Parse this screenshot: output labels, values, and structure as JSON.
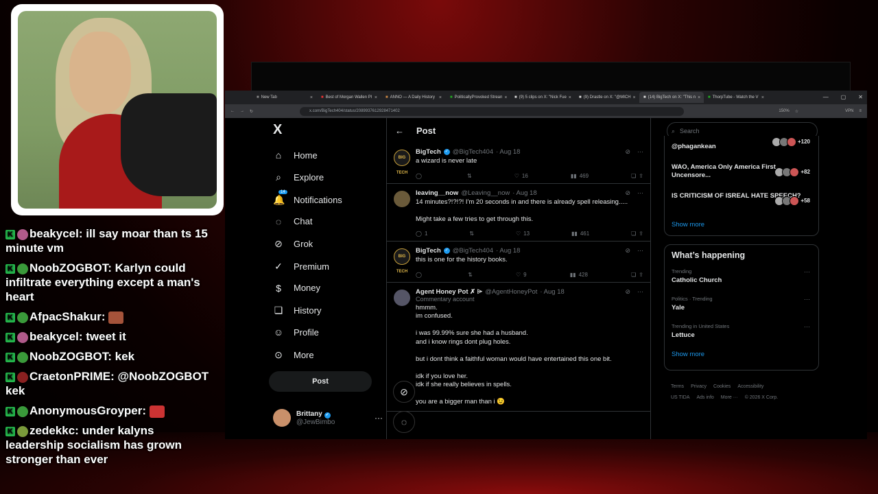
{
  "browser": {
    "tabs": [
      {
        "label": "New Tab"
      },
      {
        "label": "Best of Morgan Wallen Pl"
      },
      {
        "label": "ANNO — A Daily History"
      },
      {
        "label": "PoliticallyProvoked Strean"
      },
      {
        "label": "(9) 5 clips on X: \"Nick Fue"
      },
      {
        "label": "(9) Drastle on X: \"@MICH"
      },
      {
        "label": "(14) BigTech on X: \"This n"
      },
      {
        "label": "ThorpTube - Watch the V"
      }
    ],
    "url": "x.com/BigTech404/status/2089937612928471402",
    "zoom": "150%",
    "vpn": "VPN"
  },
  "sidebar": {
    "logo": "X",
    "items": [
      {
        "label": "Home",
        "icon": "home-icon"
      },
      {
        "label": "Explore",
        "icon": "search-icon"
      },
      {
        "label": "Notifications",
        "icon": "bell-icon",
        "badge": "14"
      },
      {
        "label": "Chat",
        "icon": "chat-icon"
      },
      {
        "label": "Grok",
        "icon": "grok-icon"
      },
      {
        "label": "Premium",
        "icon": "premium-icon"
      },
      {
        "label": "Money",
        "icon": "money-icon"
      },
      {
        "label": "History",
        "icon": "bookmark-icon"
      },
      {
        "label": "Profile",
        "icon": "profile-icon"
      },
      {
        "label": "More",
        "icon": "more-icon"
      }
    ],
    "post_label": "Post",
    "account": {
      "name": "Brittany",
      "handle": "@JewBimbo"
    }
  },
  "timeline": {
    "title": "Post",
    "tweets": [
      {
        "name": "BigTech",
        "handle": "@BigTech404",
        "date": "· Aug 18",
        "avatar_text": "BIG TECH",
        "lines": [
          "a wizard is never late"
        ],
        "reposts": "",
        "likes": "16",
        "views": "469",
        "replies": ""
      },
      {
        "name": "leaving__now",
        "handle": "@Leaving__now",
        "date": "· Aug 18",
        "avatar_text": "",
        "lines": [
          "14 minutes?!?!?! I'm 20 seconds in and there is already spell releasing.....",
          "",
          "Might take a few tries to get through this."
        ],
        "replies": "1",
        "reposts": "",
        "likes": "13",
        "views": "461"
      },
      {
        "name": "BigTech",
        "handle": "@BigTech404",
        "date": "· Aug 18",
        "avatar_text": "BIG TECH",
        "lines": [
          "this is one for the history books."
        ],
        "replies": "",
        "reposts": "",
        "likes": "9",
        "views": "428"
      },
      {
        "name": "Agent Honey Pot ✗ ⌲",
        "handle": "@AgentHoneyPot",
        "date": "· Aug 18",
        "avatar_text": "",
        "commentary": "Commentary account",
        "lines": [
          "hmmm.",
          "im confused.",
          "",
          "i was 99.99% sure she had a husband.",
          "and i know rings dont plug holes.",
          "",
          "but i dont think a faithful woman would have entertained this one bit.",
          "",
          "idk if you love her.",
          "idk if she really believes in spells.",
          "",
          "you are a bigger man than i 😉"
        ]
      }
    ]
  },
  "right": {
    "search_placeholder": "Search",
    "live": [
      {
        "title": "@phagankean",
        "count": "+120"
      },
      {
        "title": "WAO, America Only America First Uncensore...",
        "count": "+82"
      },
      {
        "title": "IS CRITICISM OF ISREAL HATE SPEECH?",
        "count": "+58"
      }
    ],
    "show_more": "Show more",
    "happening_title": "What’s happening",
    "trends": [
      {
        "category": "Trending",
        "name": "Catholic Church"
      },
      {
        "category": "Politics · Trending",
        "name": "Yale"
      },
      {
        "category": "Trending in United States",
        "name": "Lettuce"
      }
    ],
    "show_more2": "Show more",
    "footer": [
      "Terms",
      "Privacy",
      "Cookies",
      "Accessibility",
      "US TIDA",
      "Ads info",
      "More ···",
      "© 2026 X Corp."
    ]
  },
  "chat": [
    {
      "user": "beakycel",
      "text": "ill say moar than ts 15 minute vm",
      "avatar_color": "#b05a8a"
    },
    {
      "user": "NoobZOGBOT",
      "text": "Karlyn could infiltrate everything except a man's heart",
      "avatar_color": "#3a9a3a"
    },
    {
      "user": "AfpacShakur",
      "text": "",
      "avatar_color": "#3a9a3a",
      "emote": true
    },
    {
      "user": "beakycel",
      "text": "tweet it",
      "avatar_color": "#b05a8a"
    },
    {
      "user": "NoobZOGBOT",
      "text": "kek",
      "avatar_color": "#3a9a3a"
    },
    {
      "user": "CraetonPRIME",
      "text": "@NoobZOGBOT kek",
      "avatar_color": "#8a2020"
    },
    {
      "user": "AnonymousGroyper",
      "text": "",
      "avatar_color": "#3a9a3a",
      "emote": true
    },
    {
      "user": "zedekkc",
      "text": "under kalyns leadership socialism has grown stronger than ever",
      "avatar_color": "#7a9a3a"
    }
  ]
}
